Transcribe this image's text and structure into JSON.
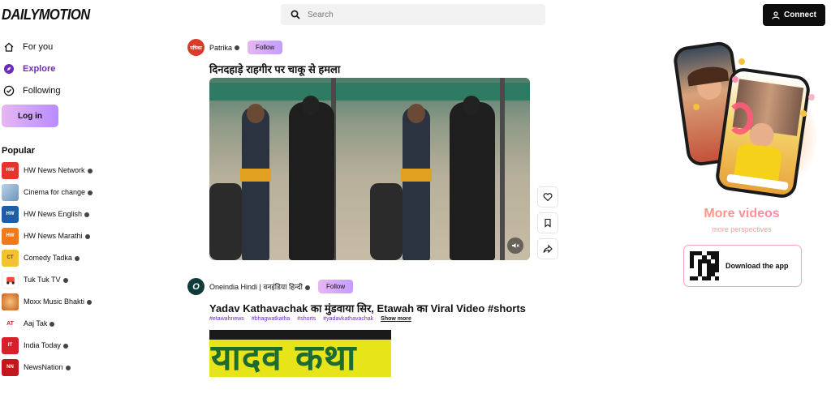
{
  "header": {
    "logo": "DAILYMOTION",
    "search_placeholder": "Search",
    "connect_label": "Connect"
  },
  "nav": {
    "items": [
      {
        "label": "For you",
        "icon": "home-icon"
      },
      {
        "label": "Explore",
        "icon": "compass-icon",
        "active": true
      },
      {
        "label": "Following",
        "icon": "check-circle-icon"
      }
    ],
    "login_label": "Log in"
  },
  "popular": {
    "title": "Popular",
    "channels": [
      {
        "name": "HW News Network",
        "avatar_text": "HW",
        "color": "#e8322b"
      },
      {
        "name": "Cinema for change",
        "avatar_text": "",
        "color": "#8fb4d8"
      },
      {
        "name": "HW News English",
        "avatar_text": "HW",
        "color": "#1c5fa8"
      },
      {
        "name": "HW News Marathi",
        "avatar_text": "HW",
        "color": "#f07a1a"
      },
      {
        "name": "Comedy Tadka",
        "avatar_text": "CT",
        "color": "#f2c230"
      },
      {
        "name": "Tuk Tuk TV",
        "avatar_text": "",
        "color": "#ffffff"
      },
      {
        "name": "Moxx Music Bhakti",
        "avatar_text": "",
        "color": "#e07b2e"
      },
      {
        "name": "Aaj Tak",
        "avatar_text": "AT",
        "color": "#ffffff"
      },
      {
        "name": "India Today",
        "avatar_text": "IT",
        "color": "#d6202a"
      },
      {
        "name": "NewsNation",
        "avatar_text": "NN",
        "color": "#c4161c"
      }
    ]
  },
  "feed": {
    "post1": {
      "channel": "Patrika",
      "avatar_text": "पत्रिका",
      "avatar_color": "#d83a2c",
      "follow_label": "Follow",
      "title": "दिनदहाड़े राहगीर पर चाकू से हमला"
    },
    "post2": {
      "channel": "Oneindia Hindi | वनइंडिया हिन्दी",
      "avatar_text": "O",
      "avatar_color": "#0f3b3a",
      "follow_label": "Follow",
      "title": "Yadav Kathavachak का मुंडवाया सिर, Etawah का Viral Video #shorts",
      "tags": [
        "#etawahnews",
        "#bhagwatkatha",
        "#shorts",
        "#yadavkathavachak"
      ],
      "show_more": "Show more",
      "thumb_text": "यादव कथा"
    }
  },
  "promo": {
    "title": "More videos",
    "subtitle": "more perspectives",
    "download_label": "Download the app"
  }
}
